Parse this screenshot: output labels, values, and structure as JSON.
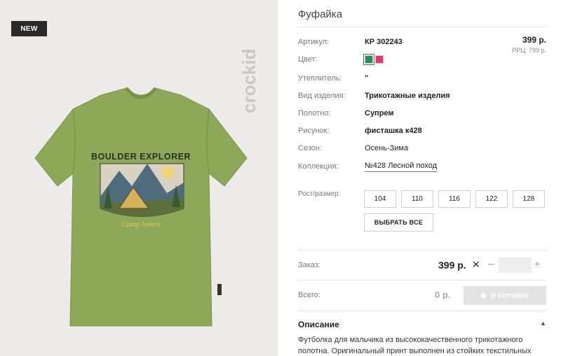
{
  "image": {
    "badge": "NEW",
    "brand": "crockid",
    "print_title": "BOULDER EXPLORER",
    "print_subtitle": "Camp lovers"
  },
  "product": {
    "title": "Фуфайка",
    "price": "399 р.",
    "rrp": "РРЦ: 799 р."
  },
  "attributes": {
    "article": {
      "label": "Артикул:",
      "value": "КР 302243"
    },
    "color": {
      "label": "Цвет:",
      "swatches": [
        "#2e8b57",
        "#e8356d"
      ]
    },
    "insulation": {
      "label": "Утеплитель:",
      "value": "\""
    },
    "type": {
      "label": "Вид изделия:",
      "value": "Трикотажные изделия"
    },
    "fabric": {
      "label": "Полотно:",
      "value": "Супрем"
    },
    "print": {
      "label": "Рисунок:",
      "value": "фисташка к428"
    },
    "season": {
      "label": "Сезон:",
      "value": "Осень-Зима"
    },
    "collection": {
      "label": "Коллекция:",
      "value": "№428 Лесной поход"
    }
  },
  "sizes": {
    "label": "Рост/размер:",
    "options": [
      "104",
      "110",
      "116",
      "122",
      "128"
    ],
    "select_all": "ВЫБРАТЬ ВСЕ"
  },
  "order": {
    "label": "Заказ:",
    "price": "399 р.",
    "remove": "✕",
    "minus": "–",
    "plus": "+",
    "quantity": ""
  },
  "total": {
    "label": "Всего:",
    "value": "0 р.",
    "cart_button": "В КОРЗИНУ"
  },
  "description": {
    "title": "Описание",
    "text": "Футболка для мальчика из высококачественного трикотажного полотна. Оригинальный принт выполнен из стойких текстильных"
  },
  "colors": {
    "tshirt": "#8ea85a",
    "image_bg": "#ecebea",
    "badge_bg": "#2a2a2a"
  }
}
